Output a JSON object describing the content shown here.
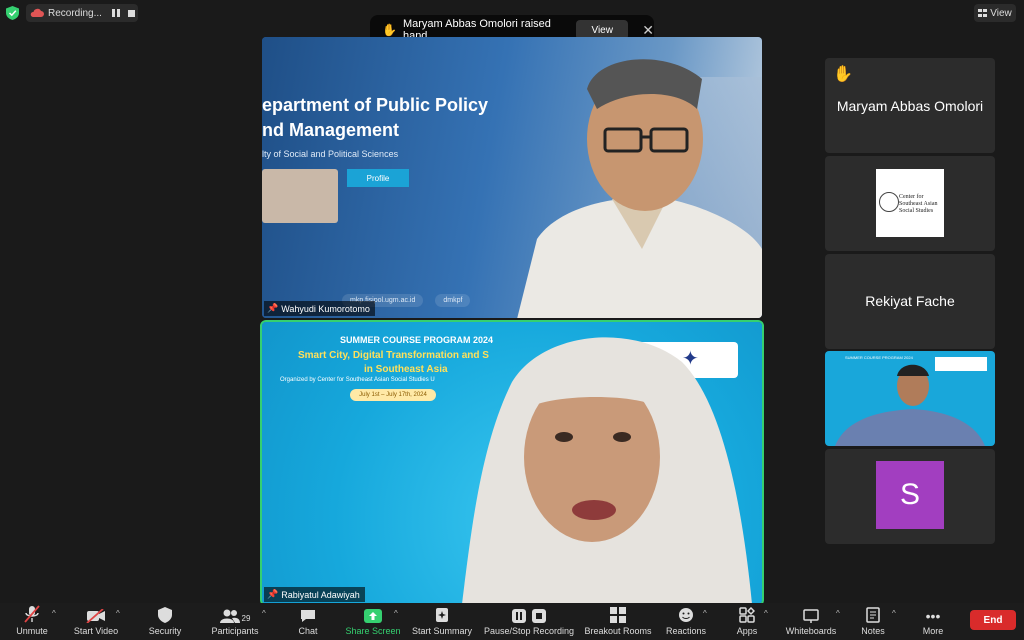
{
  "top": {
    "recording_label": "Recording...",
    "view_label": "View"
  },
  "notification": {
    "message": "Maryam Abbas Omolori raised hand",
    "view_label": "View"
  },
  "videos": {
    "main_top": {
      "name": "Wahyudi Kumorotomo",
      "slide_title": "epartment of Public Policy\nnd Management",
      "slide_subtitle": "lty of Social and Political Sciences",
      "slide_button": "Profile",
      "footer_site": "mkp.fisipol.ugm.ac.id",
      "footer_handle": "dmkpf"
    },
    "main_bottom": {
      "name": "Rabiyatul Adawiyah",
      "program": "SUMMER COURSE PROGRAM 2024",
      "headline_1": "Smart City, Digital Transformation and S",
      "headline_2": "in Southeast Asia",
      "organizer": "Organized by Center for Southeast Asian Social Studies U",
      "dates": "July 1st – July 17th, 2024",
      "logo_text": "Center for\nSoutheast Asian\nSocial Studies"
    }
  },
  "participants_panel": [
    {
      "name": "Maryam Abbas Omolori",
      "hand_raised": true
    },
    {
      "logo_text": "Center for\nSoutheast Asian\nSocial Studies"
    },
    {
      "name": "Rekiyat Fache"
    },
    {
      "video": true
    },
    {
      "avatar_letter": "S",
      "avatar_color": "#a23ec0"
    }
  ],
  "toolbar": {
    "unmute": "Unmute",
    "start_video": "Start Video",
    "security": "Security",
    "participants": "Participants",
    "participants_count": "29",
    "chat": "Chat",
    "share_screen": "Share Screen",
    "start_summary": "Start Summary",
    "pause_stop": "Pause/Stop Recording",
    "breakout": "Breakout Rooms",
    "reactions": "Reactions",
    "apps": "Apps",
    "whiteboards": "Whiteboards",
    "notes": "Notes",
    "more": "More",
    "end": "End"
  },
  "colors": {
    "share_green": "#35d070",
    "end_red": "#d92b2b",
    "tile_bg": "#2c2c2c"
  }
}
